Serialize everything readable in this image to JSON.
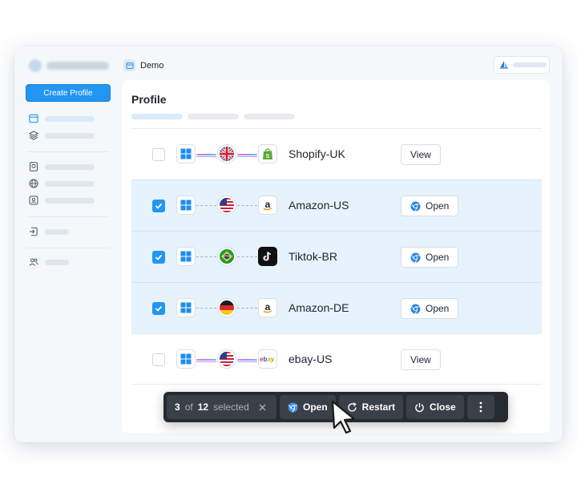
{
  "sidebar": {
    "create_label": "Create Profile",
    "nav_icons": [
      "browser-icon",
      "layers-icon",
      "id-card-icon",
      "globe-icon",
      "contact-icon",
      "import-icon",
      "team-icon"
    ]
  },
  "topbar": {
    "tab_label": "Demo"
  },
  "panel": {
    "title": "Profile"
  },
  "colors": {
    "accent": "#2196f3",
    "selected_row": "#e6f2fc",
    "bulk_bar": "#262b31"
  },
  "profiles": [
    {
      "name": "Shopify-UK",
      "selected": false,
      "os": "windows-icon",
      "country": "uk-flag-icon",
      "platform": "shopify-icon",
      "action": "View"
    },
    {
      "name": "Amazon-US",
      "selected": true,
      "os": "windows-icon",
      "country": "us-flag-icon",
      "platform": "amazon-icon",
      "action": "Open"
    },
    {
      "name": "Tiktok-BR",
      "selected": true,
      "os": "windows-icon",
      "country": "brazil-flag-icon",
      "platform": "tiktok-icon",
      "action": "Open"
    },
    {
      "name": "Amazon-DE",
      "selected": true,
      "os": "windows-icon",
      "country": "germany-flag-icon",
      "platform": "amazon-icon",
      "action": "Open"
    },
    {
      "name": "ebay-US",
      "selected": false,
      "os": "windows-icon",
      "country": "us-flag-icon",
      "platform": "ebay-icon",
      "action": "View"
    }
  ],
  "bulk": {
    "selected_count": "3",
    "of_word": "of",
    "total": "12",
    "selected_word": "selected",
    "open_label": "Open",
    "restart_label": "Restart",
    "close_label": "Close"
  }
}
